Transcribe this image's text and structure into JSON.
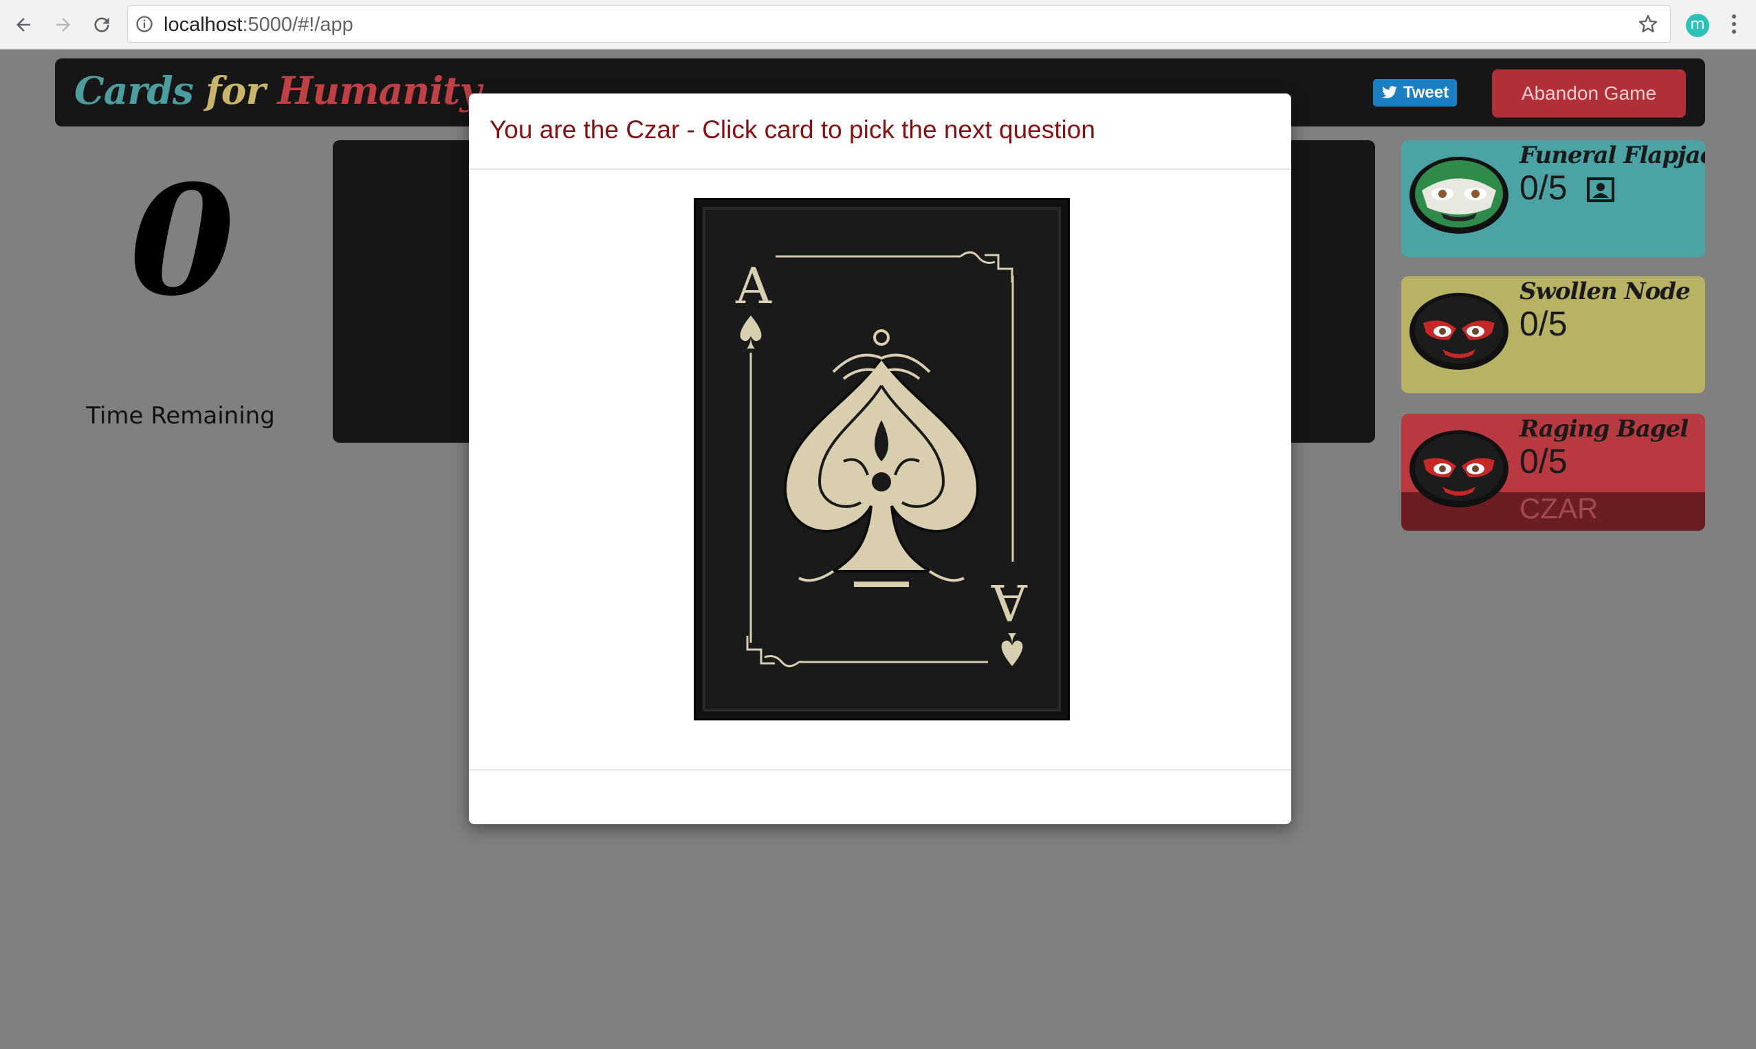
{
  "browser": {
    "url_host": "localhost",
    "url_rest": ":5000/#!/app",
    "extension_letter": "m"
  },
  "app": {
    "logo": {
      "part1": "Cards",
      "part2": "for",
      "part3": "Humanity"
    },
    "tweet_label": "Tweet",
    "abandon_label": "Abandon Game"
  },
  "timer": {
    "value": "0",
    "label": "Time Remaining"
  },
  "players": [
    {
      "name": "Funeral Flapjack",
      "score": "0/5",
      "color": "#4ca3a3",
      "mask": "green"
    },
    {
      "name": "Swollen Node",
      "score": "0/5",
      "color": "#b8b264",
      "mask": "black"
    },
    {
      "name": "Raging Bagel",
      "score": "0/5",
      "color": "#b8393f",
      "mask": "black",
      "role": "CZAR"
    }
  ],
  "modal": {
    "title": "You are the Czar - Click card to pick the next question",
    "card": {
      "rank": "A",
      "suit": "spade-icon"
    }
  },
  "colors": {
    "page_bg": "#808080",
    "panel_bg": "#161616",
    "title_red": "#8a0f10",
    "abandon_red": "#b13037",
    "tweet_blue": "#1b7fc4"
  }
}
